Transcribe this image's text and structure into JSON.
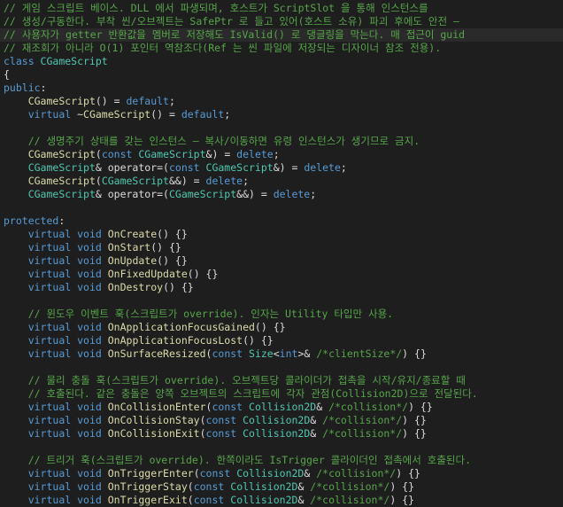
{
  "editor": {
    "theme": {
      "background": "#1e1e1e",
      "current_line": "#2a2a2a",
      "comment": "#57a64a",
      "keyword": "#569cd6",
      "type": "#4ec9b0",
      "function": "#dcdcaa",
      "plain": "#dcdcdc",
      "parameter": "#9cdcfe"
    },
    "current_line_index": 2,
    "lines": [
      [
        {
          "t": "// 게임 스크립트 베이스. DLL 에서 파생되며, 호스트가 ScriptSlot 을 통해 인스턴스를",
          "k": "comment"
        }
      ],
      [
        {
          "t": "// 생성/구동한다. 부착 씬/오브젝트는 SafePtr 로 들고 있어(호스트 소유) 파괴 후에도 안전 —",
          "k": "comment"
        }
      ],
      [
        {
          "t": "// 사용자가 getter 반환값을 멤버로 저장해도 IsValid() 로 댕글링을 막는다. 매 접근이 guid",
          "k": "comment"
        }
      ],
      [
        {
          "t": "// 재조회가 아니라 O(1) 포인터 역참조다(Ref 는 씬 파일에 저장되는 디자이너 참조 전용).",
          "k": "comment"
        }
      ],
      [
        {
          "t": "class ",
          "k": "keyword"
        },
        {
          "t": "CGameScript",
          "k": "type"
        }
      ],
      [
        {
          "t": "{",
          "k": "plain"
        }
      ],
      [
        {
          "t": "public",
          "k": "keyword"
        },
        {
          "t": ":",
          "k": "plain"
        }
      ],
      [
        {
          "t": "    ",
          "k": "plain"
        },
        {
          "t": "CGameScript",
          "k": "func"
        },
        {
          "t": "() = ",
          "k": "plain"
        },
        {
          "t": "default",
          "k": "keyword"
        },
        {
          "t": ";",
          "k": "plain"
        }
      ],
      [
        {
          "t": "    ",
          "k": "plain"
        },
        {
          "t": "virtual",
          "k": "keyword"
        },
        {
          "t": " ~",
          "k": "plain"
        },
        {
          "t": "CGameScript",
          "k": "func"
        },
        {
          "t": "() = ",
          "k": "plain"
        },
        {
          "t": "default",
          "k": "keyword"
        },
        {
          "t": ";",
          "k": "plain"
        }
      ],
      [],
      [
        {
          "t": "    ",
          "k": "plain"
        },
        {
          "t": "// 생명주기 상태를 갖는 인스턴스 — 복사/이동하면 유령 인스턴스가 생기므로 금지.",
          "k": "comment"
        }
      ],
      [
        {
          "t": "    ",
          "k": "plain"
        },
        {
          "t": "CGameScript",
          "k": "func"
        },
        {
          "t": "(",
          "k": "plain"
        },
        {
          "t": "const",
          "k": "keyword"
        },
        {
          "t": " ",
          "k": "plain"
        },
        {
          "t": "CGameScript",
          "k": "type"
        },
        {
          "t": "&) = ",
          "k": "plain"
        },
        {
          "t": "delete",
          "k": "keyword"
        },
        {
          "t": ";",
          "k": "plain"
        }
      ],
      [
        {
          "t": "    ",
          "k": "plain"
        },
        {
          "t": "CGameScript",
          "k": "type"
        },
        {
          "t": "& operator=(",
          "k": "plain"
        },
        {
          "t": "const",
          "k": "keyword"
        },
        {
          "t": " ",
          "k": "plain"
        },
        {
          "t": "CGameScript",
          "k": "type"
        },
        {
          "t": "&) = ",
          "k": "plain"
        },
        {
          "t": "delete",
          "k": "keyword"
        },
        {
          "t": ";",
          "k": "plain"
        }
      ],
      [
        {
          "t": "    ",
          "k": "plain"
        },
        {
          "t": "CGameScript",
          "k": "func"
        },
        {
          "t": "(",
          "k": "plain"
        },
        {
          "t": "CGameScript",
          "k": "type"
        },
        {
          "t": "&&) = ",
          "k": "plain"
        },
        {
          "t": "delete",
          "k": "keyword"
        },
        {
          "t": ";",
          "k": "plain"
        }
      ],
      [
        {
          "t": "    ",
          "k": "plain"
        },
        {
          "t": "CGameScript",
          "k": "type"
        },
        {
          "t": "& operator=(",
          "k": "plain"
        },
        {
          "t": "CGameScript",
          "k": "type"
        },
        {
          "t": "&&) = ",
          "k": "plain"
        },
        {
          "t": "delete",
          "k": "keyword"
        },
        {
          "t": ";",
          "k": "plain"
        }
      ],
      [],
      [
        {
          "t": "protected",
          "k": "keyword"
        },
        {
          "t": ":",
          "k": "plain"
        }
      ],
      [
        {
          "t": "    ",
          "k": "plain"
        },
        {
          "t": "virtual",
          "k": "keyword"
        },
        {
          "t": " ",
          "k": "plain"
        },
        {
          "t": "void",
          "k": "keyword"
        },
        {
          "t": " ",
          "k": "plain"
        },
        {
          "t": "OnCreate",
          "k": "func"
        },
        {
          "t": "() {}",
          "k": "plain"
        }
      ],
      [
        {
          "t": "    ",
          "k": "plain"
        },
        {
          "t": "virtual",
          "k": "keyword"
        },
        {
          "t": " ",
          "k": "plain"
        },
        {
          "t": "void",
          "k": "keyword"
        },
        {
          "t": " ",
          "k": "plain"
        },
        {
          "t": "OnStart",
          "k": "func"
        },
        {
          "t": "() {}",
          "k": "plain"
        }
      ],
      [
        {
          "t": "    ",
          "k": "plain"
        },
        {
          "t": "virtual",
          "k": "keyword"
        },
        {
          "t": " ",
          "k": "plain"
        },
        {
          "t": "void",
          "k": "keyword"
        },
        {
          "t": " ",
          "k": "plain"
        },
        {
          "t": "OnUpdate",
          "k": "func"
        },
        {
          "t": "() {}",
          "k": "plain"
        }
      ],
      [
        {
          "t": "    ",
          "k": "plain"
        },
        {
          "t": "virtual",
          "k": "keyword"
        },
        {
          "t": " ",
          "k": "plain"
        },
        {
          "t": "void",
          "k": "keyword"
        },
        {
          "t": " ",
          "k": "plain"
        },
        {
          "t": "OnFixedUpdate",
          "k": "func"
        },
        {
          "t": "() {}",
          "k": "plain"
        }
      ],
      [
        {
          "t": "    ",
          "k": "plain"
        },
        {
          "t": "virtual",
          "k": "keyword"
        },
        {
          "t": " ",
          "k": "plain"
        },
        {
          "t": "void",
          "k": "keyword"
        },
        {
          "t": " ",
          "k": "plain"
        },
        {
          "t": "OnDestroy",
          "k": "func"
        },
        {
          "t": "() {}",
          "k": "plain"
        }
      ],
      [],
      [
        {
          "t": "    ",
          "k": "plain"
        },
        {
          "t": "// 윈도우 이벤트 훅(스크립트가 override). 인자는 Utility 타입만 사용.",
          "k": "comment"
        }
      ],
      [
        {
          "t": "    ",
          "k": "plain"
        },
        {
          "t": "virtual",
          "k": "keyword"
        },
        {
          "t": " ",
          "k": "plain"
        },
        {
          "t": "void",
          "k": "keyword"
        },
        {
          "t": " ",
          "k": "plain"
        },
        {
          "t": "OnApplicationFocusGained",
          "k": "func"
        },
        {
          "t": "() {}",
          "k": "plain"
        }
      ],
      [
        {
          "t": "    ",
          "k": "plain"
        },
        {
          "t": "virtual",
          "k": "keyword"
        },
        {
          "t": " ",
          "k": "plain"
        },
        {
          "t": "void",
          "k": "keyword"
        },
        {
          "t": " ",
          "k": "plain"
        },
        {
          "t": "OnApplicationFocusLost",
          "k": "func"
        },
        {
          "t": "() {}",
          "k": "plain"
        }
      ],
      [
        {
          "t": "    ",
          "k": "plain"
        },
        {
          "t": "virtual",
          "k": "keyword"
        },
        {
          "t": " ",
          "k": "plain"
        },
        {
          "t": "void",
          "k": "keyword"
        },
        {
          "t": " ",
          "k": "plain"
        },
        {
          "t": "OnSurfaceResized",
          "k": "func"
        },
        {
          "t": "(",
          "k": "plain"
        },
        {
          "t": "const",
          "k": "keyword"
        },
        {
          "t": " ",
          "k": "plain"
        },
        {
          "t": "Size",
          "k": "type"
        },
        {
          "t": "<",
          "k": "plain"
        },
        {
          "t": "int",
          "k": "keyword"
        },
        {
          "t": ">& ",
          "k": "plain"
        },
        {
          "t": "/*clientSize*/",
          "k": "comment"
        },
        {
          "t": ") {}",
          "k": "plain"
        }
      ],
      [],
      [
        {
          "t": "    ",
          "k": "plain"
        },
        {
          "t": "// 물리 충돌 훅(스크립트가 override). 오브젝트당 콜라이더가 접촉을 시작/유지/종료할 때",
          "k": "comment"
        }
      ],
      [
        {
          "t": "    ",
          "k": "plain"
        },
        {
          "t": "// 호출된다. 같은 충돌은 양쪽 오브젝트의 스크립트에 각자 관점(Collision2D)으로 전달된다.",
          "k": "comment"
        }
      ],
      [
        {
          "t": "    ",
          "k": "plain"
        },
        {
          "t": "virtual",
          "k": "keyword"
        },
        {
          "t": " ",
          "k": "plain"
        },
        {
          "t": "void",
          "k": "keyword"
        },
        {
          "t": " ",
          "k": "plain"
        },
        {
          "t": "OnCollisionEnter",
          "k": "func"
        },
        {
          "t": "(",
          "k": "plain"
        },
        {
          "t": "const",
          "k": "keyword"
        },
        {
          "t": " ",
          "k": "plain"
        },
        {
          "t": "Collision2D",
          "k": "type"
        },
        {
          "t": "& ",
          "k": "plain"
        },
        {
          "t": "/*collision*/",
          "k": "comment"
        },
        {
          "t": ") {}",
          "k": "plain"
        }
      ],
      [
        {
          "t": "    ",
          "k": "plain"
        },
        {
          "t": "virtual",
          "k": "keyword"
        },
        {
          "t": " ",
          "k": "plain"
        },
        {
          "t": "void",
          "k": "keyword"
        },
        {
          "t": " ",
          "k": "plain"
        },
        {
          "t": "OnCollisionStay",
          "k": "func"
        },
        {
          "t": "(",
          "k": "plain"
        },
        {
          "t": "const",
          "k": "keyword"
        },
        {
          "t": " ",
          "k": "plain"
        },
        {
          "t": "Collision2D",
          "k": "type"
        },
        {
          "t": "& ",
          "k": "plain"
        },
        {
          "t": "/*collision*/",
          "k": "comment"
        },
        {
          "t": ") {}",
          "k": "plain"
        }
      ],
      [
        {
          "t": "    ",
          "k": "plain"
        },
        {
          "t": "virtual",
          "k": "keyword"
        },
        {
          "t": " ",
          "k": "plain"
        },
        {
          "t": "void",
          "k": "keyword"
        },
        {
          "t": " ",
          "k": "plain"
        },
        {
          "t": "OnCollisionExit",
          "k": "func"
        },
        {
          "t": "(",
          "k": "plain"
        },
        {
          "t": "const",
          "k": "keyword"
        },
        {
          "t": " ",
          "k": "plain"
        },
        {
          "t": "Collision2D",
          "k": "type"
        },
        {
          "t": "& ",
          "k": "plain"
        },
        {
          "t": "/*collision*/",
          "k": "comment"
        },
        {
          "t": ") {}",
          "k": "plain"
        }
      ],
      [],
      [
        {
          "t": "    ",
          "k": "plain"
        },
        {
          "t": "// 트리거 훅(스크립트가 override). 한쪽이라도 IsTrigger 콜라이더인 접촉에서 호출된다.",
          "k": "comment"
        }
      ],
      [
        {
          "t": "    ",
          "k": "plain"
        },
        {
          "t": "virtual",
          "k": "keyword"
        },
        {
          "t": " ",
          "k": "plain"
        },
        {
          "t": "void",
          "k": "keyword"
        },
        {
          "t": " ",
          "k": "plain"
        },
        {
          "t": "OnTriggerEnter",
          "k": "func"
        },
        {
          "t": "(",
          "k": "plain"
        },
        {
          "t": "const",
          "k": "keyword"
        },
        {
          "t": " ",
          "k": "plain"
        },
        {
          "t": "Collision2D",
          "k": "type"
        },
        {
          "t": "& ",
          "k": "plain"
        },
        {
          "t": "/*collision*/",
          "k": "comment"
        },
        {
          "t": ") {}",
          "k": "plain"
        }
      ],
      [
        {
          "t": "    ",
          "k": "plain"
        },
        {
          "t": "virtual",
          "k": "keyword"
        },
        {
          "t": " ",
          "k": "plain"
        },
        {
          "t": "void",
          "k": "keyword"
        },
        {
          "t": " ",
          "k": "plain"
        },
        {
          "t": "OnTriggerStay",
          "k": "func"
        },
        {
          "t": "(",
          "k": "plain"
        },
        {
          "t": "const",
          "k": "keyword"
        },
        {
          "t": " ",
          "k": "plain"
        },
        {
          "t": "Collision2D",
          "k": "type"
        },
        {
          "t": "& ",
          "k": "plain"
        },
        {
          "t": "/*collision*/",
          "k": "comment"
        },
        {
          "t": ") {}",
          "k": "plain"
        }
      ],
      [
        {
          "t": "    ",
          "k": "plain"
        },
        {
          "t": "virtual",
          "k": "keyword"
        },
        {
          "t": " ",
          "k": "plain"
        },
        {
          "t": "void",
          "k": "keyword"
        },
        {
          "t": " ",
          "k": "plain"
        },
        {
          "t": "OnTriggerExit",
          "k": "func"
        },
        {
          "t": "(",
          "k": "plain"
        },
        {
          "t": "const",
          "k": "keyword"
        },
        {
          "t": " ",
          "k": "plain"
        },
        {
          "t": "Collision2D",
          "k": "type"
        },
        {
          "t": "& ",
          "k": "plain"
        },
        {
          "t": "/*collision*/",
          "k": "comment"
        },
        {
          "t": ") {}",
          "k": "plain"
        }
      ]
    ]
  }
}
